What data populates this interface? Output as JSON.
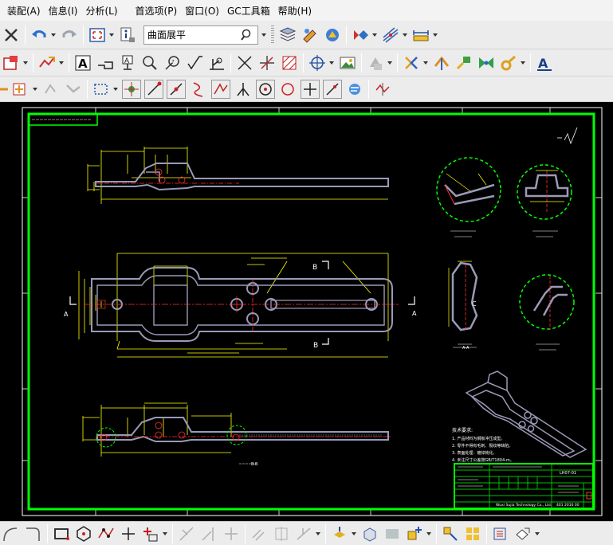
{
  "menu": {
    "items": [
      {
        "label": "装配(A)"
      },
      {
        "label": "信息(I)"
      },
      {
        "label": "分析(L)"
      },
      {
        "label": "首选项(P)"
      },
      {
        "label": "窗口(O)"
      },
      {
        "label": "GC工具箱"
      },
      {
        "label": "帮助(H)"
      }
    ]
  },
  "toolbar": {
    "command_search_value": "曲面展平"
  },
  "drawing": {
    "colors": {
      "background": "#000000",
      "border": "#00ff00",
      "outline": "#ffff00",
      "part": "#9a9ab8",
      "centerline": "#ff3030",
      "detail_circle": "#00ff00"
    },
    "section_label_b": "B",
    "section_label_a": "A",
    "cross_label": "A-A",
    "section_label_bb": "B-B",
    "detail_c": "C",
    "notes_title": "技术要求:",
    "notes": [
      "1. 产品材料为钢板冲压成型。",
      "2. 零件不得有毛刺、裂纹等缺陷。",
      "3. 表面处理：镀锌钝化。",
      "4. 未注尺寸公差按GB/T1804-m。"
    ],
    "title_block_company": "Wuxi Sujia Technology Co., Ltd.",
    "title_block_part": "LH07-01",
    "title_block_code": "401 2016 00"
  }
}
